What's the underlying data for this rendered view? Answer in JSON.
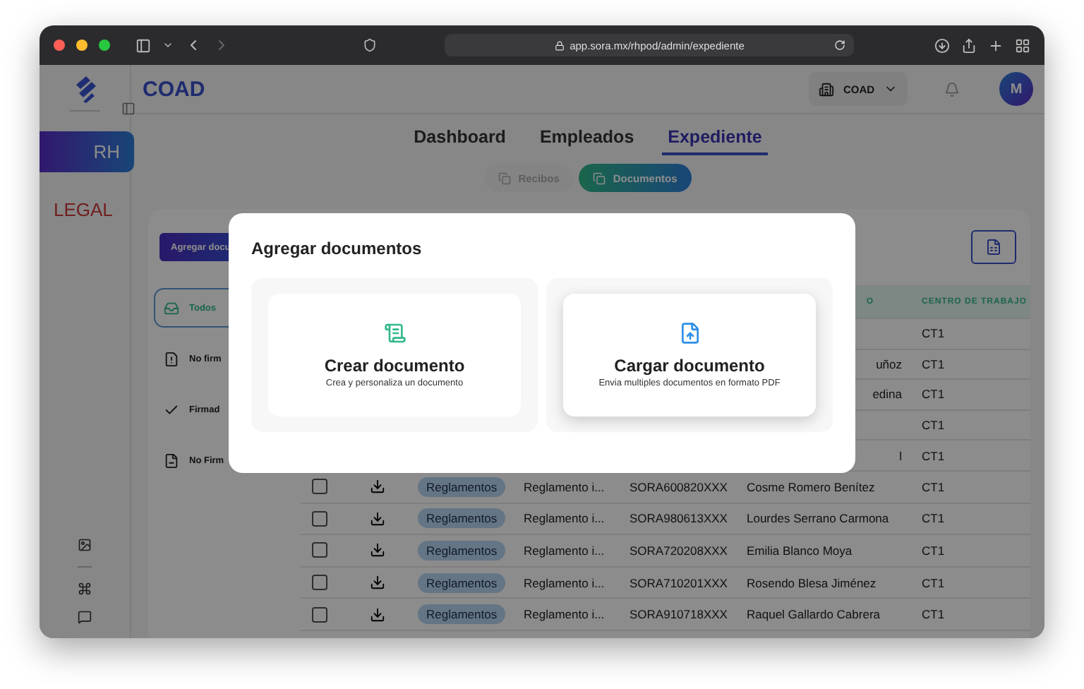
{
  "browser": {
    "url": "app.sora.mx/rhpod/admin/expediente"
  },
  "sidebar": {
    "items": [
      {
        "label": "RH",
        "selected": true
      },
      {
        "label": "LEGAL",
        "selected": false
      }
    ]
  },
  "header": {
    "brand": "COAD",
    "company": "COAD",
    "avatar": "M"
  },
  "nav_tabs": [
    {
      "label": "Dashboard",
      "selected": false
    },
    {
      "label": "Empleados",
      "selected": false
    },
    {
      "label": "Expediente",
      "selected": true
    }
  ],
  "sub_tabs": [
    {
      "label": "Recibos",
      "selected": false
    },
    {
      "label": "Documentos",
      "selected": true
    }
  ],
  "add_button": "Agregar docu",
  "filters": [
    {
      "label": "Todos",
      "kind": "inbox",
      "selected": true
    },
    {
      "label": "No firm",
      "kind": "warning",
      "selected": false
    },
    {
      "label": "Firmad",
      "kind": "check",
      "selected": false
    },
    {
      "label": "No Firm",
      "kind": "minus",
      "selected": false
    }
  ],
  "table": {
    "columns": [
      "O",
      "CENTRO DE TRABAJO"
    ],
    "rows": [
      {
        "kind": "covered",
        "centro": "CT1"
      },
      {
        "kind": "covered",
        "name": "uñoz",
        "centro": "CT1"
      },
      {
        "kind": "covered",
        "name": "edina",
        "centro": "CT1"
      },
      {
        "kind": "covered",
        "centro": "CT1"
      },
      {
        "kind": "covered",
        "name": "l",
        "centro": "CT1"
      },
      {
        "kind": "full",
        "checked": false,
        "tag": "Reglamentos",
        "document": "Reglamento i...",
        "rfc": "SORA600820XXX",
        "name": "Cosme Romero Benítez",
        "centro": "CT1"
      },
      {
        "kind": "full",
        "checked": false,
        "tag": "Reglamentos",
        "document": "Reglamento i...",
        "rfc": "SORA980613XXX",
        "name": "Lourdes Serrano Carmona",
        "centro": "CT1"
      },
      {
        "kind": "full",
        "checked": false,
        "tag": "Reglamentos",
        "document": "Reglamento i...",
        "rfc": "SORA720208XXX",
        "name": "Emilia Blanco Moya",
        "centro": "CT1"
      },
      {
        "kind": "full",
        "checked": false,
        "tag": "Reglamentos",
        "document": "Reglamento i...",
        "rfc": "SORA710201XXX",
        "name": "Rosendo Blesa Jiménez",
        "centro": "CT1"
      },
      {
        "kind": "full",
        "checked": false,
        "tag": "Reglamentos",
        "document": "Reglamento i...",
        "rfc": "SORA910718XXX",
        "name": "Raquel Gallardo Cabrera",
        "centro": "CT1"
      }
    ]
  },
  "modal": {
    "title": "Agregar documentos",
    "options": [
      {
        "kind": "create",
        "title": "Crear documento",
        "subtitle": "Crea y personaliza un documento",
        "selected": false
      },
      {
        "kind": "upload",
        "title": "Cargar documento",
        "subtitle": "Envia multiples documentos en formato PDF",
        "selected": true
      }
    ]
  }
}
